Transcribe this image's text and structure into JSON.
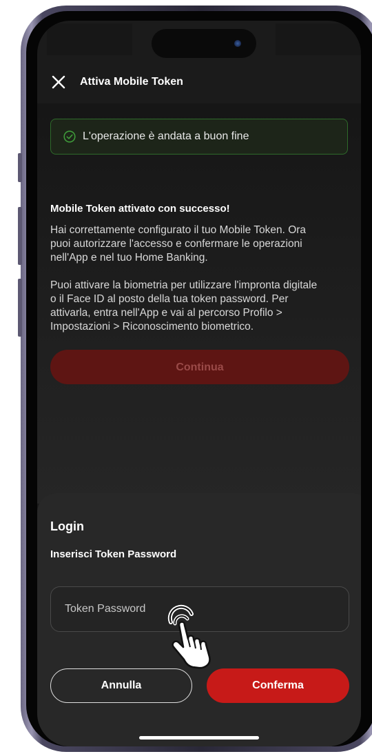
{
  "appbar": {
    "title": "Attiva Mobile Token"
  },
  "banner": {
    "text": "L'operazione è andata a buon fine",
    "icon": "check-circle-icon",
    "color": "#2e6b2a"
  },
  "message": {
    "heading": "Mobile Token attivato con successo!",
    "paragraph1_line1": "Hai correttamente configurato il tuo Mobile Token. Ora",
    "paragraph1_line2": "puoi autorizzare l'accesso e confermare le operazioni",
    "paragraph1_line3": "nell'App e nel tuo Home Banking.",
    "paragraph2_line1": "Puoi attivare la biometria per utilizzare l'impronta digitale",
    "paragraph2_line2": "o il Face ID al posto della tua token password. Per",
    "paragraph2_line3": "attivarla, entra nell'App e vai al percorso Profilo >",
    "paragraph2_line4": "Impostazioni > Riconoscimento biometrico."
  },
  "continue_button": {
    "label": "Continua"
  },
  "login_sheet": {
    "title": "Login",
    "subtitle": "Inserisci Token Password",
    "input_placeholder": "Token Password",
    "input_value": "",
    "cancel_label": "Annulla",
    "confirm_label": "Conferma"
  },
  "colors": {
    "brand_red": "#c71a18",
    "success_green": "#2e6b2a"
  }
}
